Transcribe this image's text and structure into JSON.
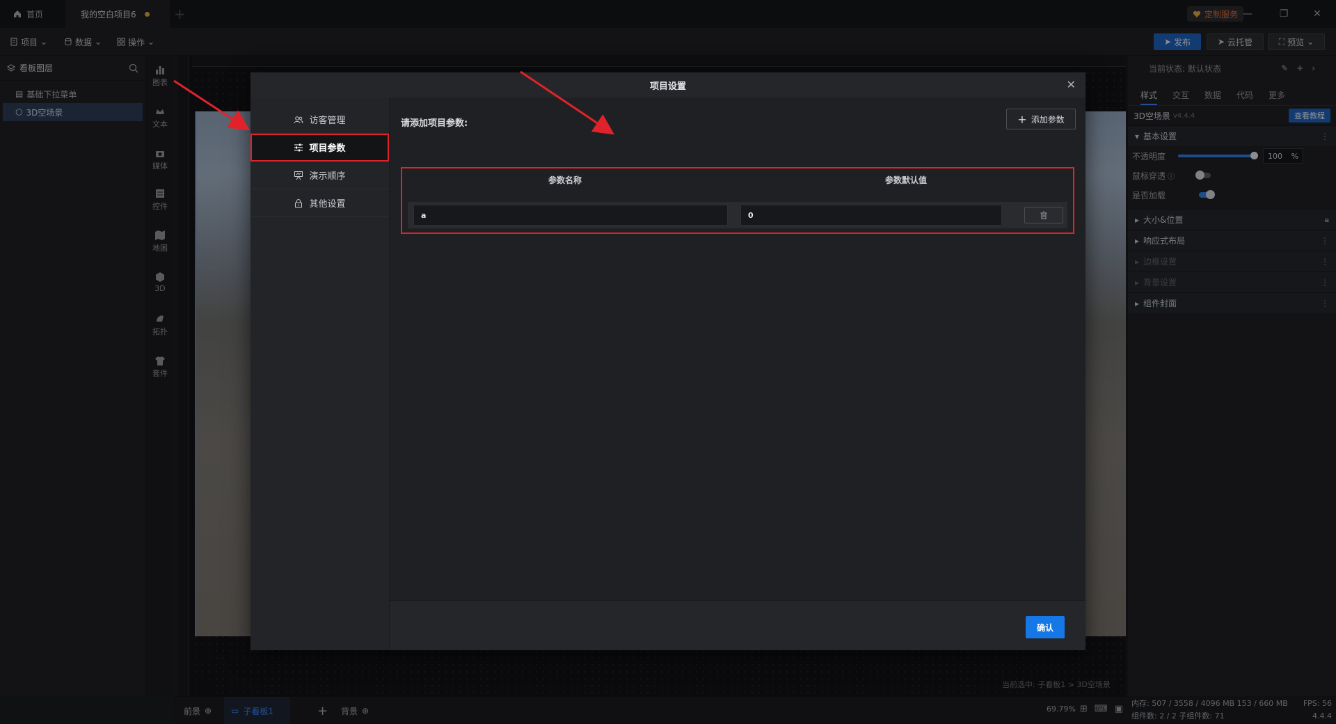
{
  "titlebar": {
    "home_tab": "首页",
    "project_tab": "我的空白项目6",
    "custom_service": "定制服务"
  },
  "toolbar": {
    "menus": [
      "项目",
      "数据",
      "操作"
    ],
    "publish": "发布",
    "cloud": "云托管",
    "preview": "预览"
  },
  "layers": {
    "title": "看板图层",
    "items": [
      "基础下拉菜单",
      "3D空场景"
    ]
  },
  "components": [
    "图表",
    "文本",
    "媒体",
    "控件",
    "地图",
    "3D",
    "拓扑",
    "套件"
  ],
  "canvas": {
    "status_hint": "当前选中: 子看板1 > 3D空场景"
  },
  "bottombar": {
    "front": "前景",
    "board": "子看板1",
    "background": "背景",
    "zoom": "69.79%"
  },
  "rpanel": {
    "state": "当前状态: 默认状态",
    "tabs": [
      "样式",
      "交互",
      "数据",
      "代码",
      "更多"
    ],
    "component_name": "3D空场景",
    "version": "v4.4.4",
    "tutorial": "查看教程",
    "basic": "基本设置",
    "opacity_label": "不透明度",
    "opacity_value": "100",
    "opacity_unit": "%",
    "mouse_through": "鼠标穿透",
    "loaded": "是否加载",
    "sections": [
      "大小&位置",
      "响应式布局",
      "边框设置",
      "背景设置",
      "组件封面"
    ],
    "opacity_fraction": 1.0
  },
  "sysinfo": {
    "memory": "内存: 507 / 3558 / 4096 MB  153 / 660 MB",
    "fps": "FPS: 56",
    "counts": "组件数: 2 / 2   子组件数: 71",
    "ver": "4.4.4"
  },
  "modal": {
    "title": "项目设置",
    "nav": [
      "访客管理",
      "项目参数",
      "演示顺序",
      "其他设置"
    ],
    "prompt": "请添加项目参数:",
    "add_button": "添加参数",
    "col_name": "参数名称",
    "col_default": "参数默认值",
    "param_name": "a",
    "param_default": "0",
    "confirm": "确认"
  },
  "colors": {
    "accent": "#1677e6",
    "highlight": "#e0232b"
  }
}
